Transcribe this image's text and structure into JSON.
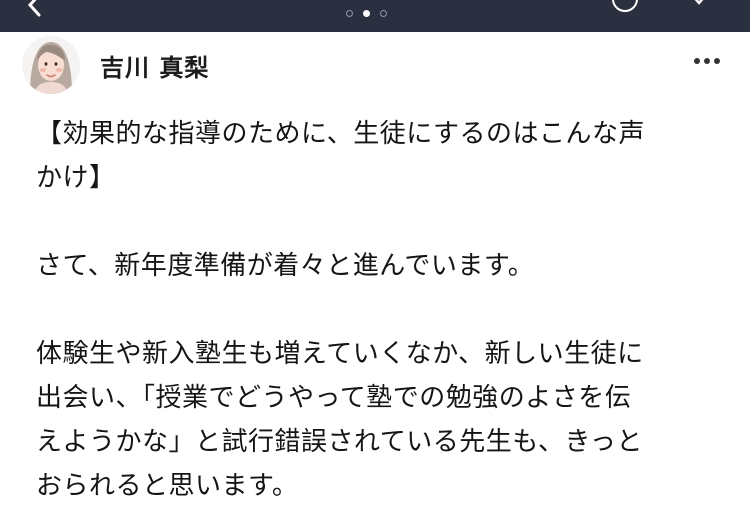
{
  "author": {
    "name": "吉川 真梨"
  },
  "post": {
    "title_line1": "【効果的な指導のために、生徒にするのはこんな声",
    "title_line2": "かけ】",
    "para1": "さて、新年度準備が着々と進んでいます。",
    "para2_line1": "体験生や新入塾生も増えていくなか、新しい生徒に",
    "para2_line2": "出会い、「授業でどうやって塾での勉強のよさを伝",
    "para2_line3": "えようかな」と試行錯誤されている先生も、きっと",
    "para2_line4": "おられると思います。"
  },
  "icons": {
    "back": "chevron-left-icon",
    "more": "more-horizontal-icon"
  },
  "colors": {
    "topbar": "#2b3040",
    "text": "#151515"
  }
}
